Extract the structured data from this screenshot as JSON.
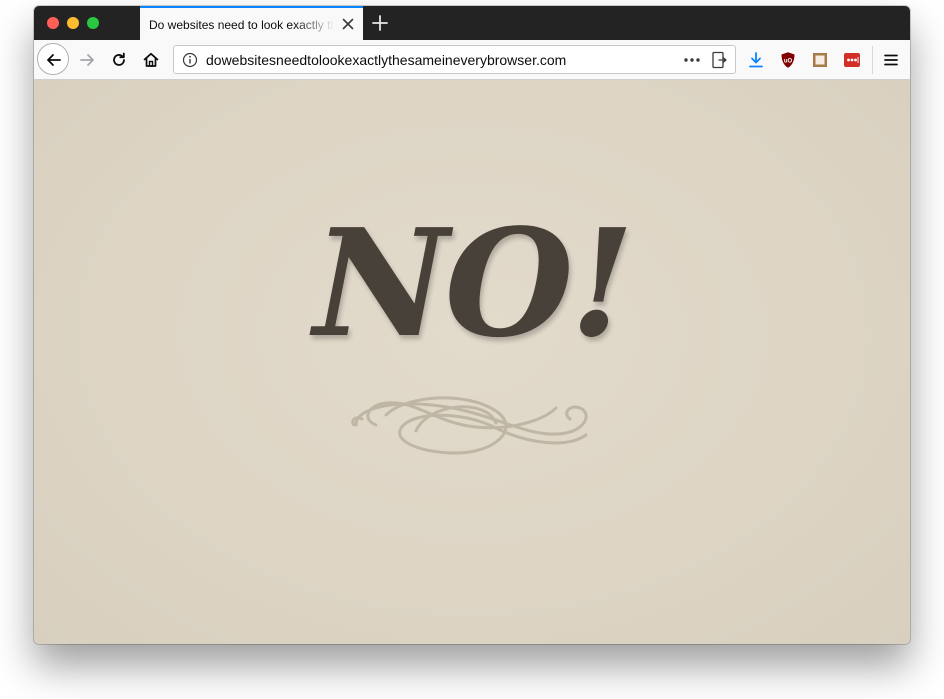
{
  "browser": {
    "tab": {
      "title": "Do websites need to look exactly the same in every browser?"
    },
    "url": "dowebsitesneedtolookexactlythesameineverybrowser.com",
    "accent_color": "#0a84ff"
  },
  "icons": {
    "back": "back-arrow-icon",
    "forward": "forward-arrow-icon",
    "reload": "reload-icon",
    "home": "home-icon",
    "info": "info-icon",
    "more": "more-ellipsis-icon",
    "reader": "reader-view-icon",
    "download": "download-icon",
    "ublock": "ublock-shield-icon",
    "extension": "square-extension-icon",
    "lastpass": "lastpass-icon",
    "menu": "hamburger-menu-icon"
  },
  "page": {
    "headline": "NO!",
    "text_color": "#47413a",
    "background_color": "#ded5c5"
  }
}
